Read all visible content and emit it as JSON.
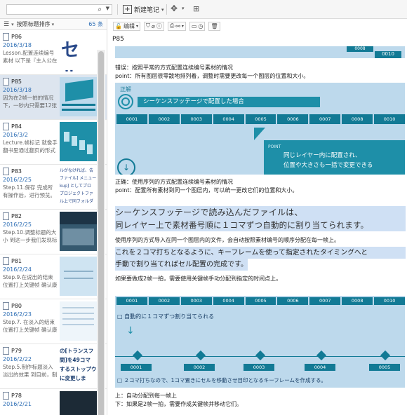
{
  "toolbar": {
    "new_note": "新建笔记",
    "search_placeholder": ""
  },
  "list": {
    "sort_label": "按照标题排序",
    "count": "65 条"
  },
  "notes": [
    {
      "title": "P86",
      "date": "2016/3/18",
      "excerpt": "Lesson.配置连续编号素材 以下是『主人公在频...",
      "thumb": "セル"
    },
    {
      "title": "P85",
      "date": "2016/3/18",
      "excerpt": "因为在2帧一拍的情况下，一秒内只需要12张图..."
    },
    {
      "title": "P84",
      "date": "2016/3/2",
      "excerpt": "Lecture.帧标记 就像手翻书里通过翻页的形式将..."
    },
    {
      "title": "P83",
      "date": "2016/2/25",
      "excerpt": "Step.11.保存 完成所有操作后，进行预览。 实时...",
      "thumb_lines": [
        "ルがなければ、告",
        "ファイル] メニュー",
        "kup] としてプロ",
        "プロジェクトファ",
        "ル上で同フォルダ"
      ]
    },
    {
      "title": "P82",
      "date": "2016/2/25",
      "excerpt": "Step.10.调整标题的大小 到这一步我们发现标题..."
    },
    {
      "title": "P81",
      "date": "2016/2/24",
      "excerpt": "Step.9.在说出的结束位置打上关键帧 确认康佛..."
    },
    {
      "title": "P80",
      "date": "2016/2/23",
      "excerpt": "Step.7. 在淡入的结束位置打上关键帧 确认康佛..."
    },
    {
      "title": "P79",
      "date": "2016/2/22",
      "excerpt": "Step.5.制作标题淡入淡出的效果 到目前，制作...",
      "thumb_lines": [
        "の[トランスフ",
        "間]を49コマ",
        "するストップウ",
        "に変更しま"
      ]
    },
    {
      "title": "P78",
      "date": "2016/2/21",
      "excerpt": ""
    }
  ],
  "editor": {
    "edit_label": "编辑",
    "note_title": "P85"
  },
  "content": {
    "wrong_label": "错误：按照平常的方式配置连续编号素材的情况",
    "wrong_point": "point：所有图层很零散地排列着，调整时需要更改每一个图层的位置和大小。",
    "img1_title": "正解",
    "img1_caption": "シーケンスフッテージで配置した場合",
    "img1_frames": [
      "0001",
      "0002",
      "0003",
      "0004",
      "0005",
      "0006",
      "0007",
      "0008",
      "0010"
    ],
    "img1_top_frames": [
      "0008",
      "0010"
    ],
    "img1_point_label": "POINT",
    "img1_point_text1": "同じレイヤー内に配置され、",
    "img1_point_text2": "位置や大きさも一括で変更できる",
    "right_label": "正确：使用序列的方式配置连续编号素材的情况",
    "right_point": "point：配置所有素材到同一个图层内，可以统一更改它们的位置和大小。",
    "jp1a": "シーケンスフッテージで読み込んだファイルは、",
    "jp1b": "同レイヤー上で素材番号順に１コマずつ自動的に割り当てられます。",
    "cn1": "使用序列的方式导入在同一个图层内的文件，会自动按照素材编号的顺序分配在每一帧上。",
    "jp2a": "これを２コマ打ちとなるように、キーフレームを使って指定されたタイミングへと",
    "jp2b": "手動で割り当てればセル配置の完成です。",
    "cn2": "如果要做成2帧一拍，需要使用关键帧手动分配到指定的时间点上。",
    "img2_frames": [
      "0001",
      "0002",
      "0003",
      "0004",
      "0005",
      "0006",
      "0007",
      "0008",
      "0010"
    ],
    "img2_auto": "□ 自動的に１コマずつ割り当てられる",
    "img2_bottom_frames": [
      "0001",
      "0002",
      "0003",
      "0004",
      "0005"
    ],
    "img2_footer": "□ ２コマ打ちなので、1コマ置きにセルを移動させ目印となるキーフレームを作成する。",
    "up_line": "上：自动分配到每一帧上",
    "down_line": "下：如果是2帧一拍，需要作成关键帧并移动它们。"
  },
  "colors": {
    "accent": "#2f6fb5",
    "teal": "#1e8fa8",
    "img_bg": "#bdd9ec",
    "frame": "#127a95"
  }
}
